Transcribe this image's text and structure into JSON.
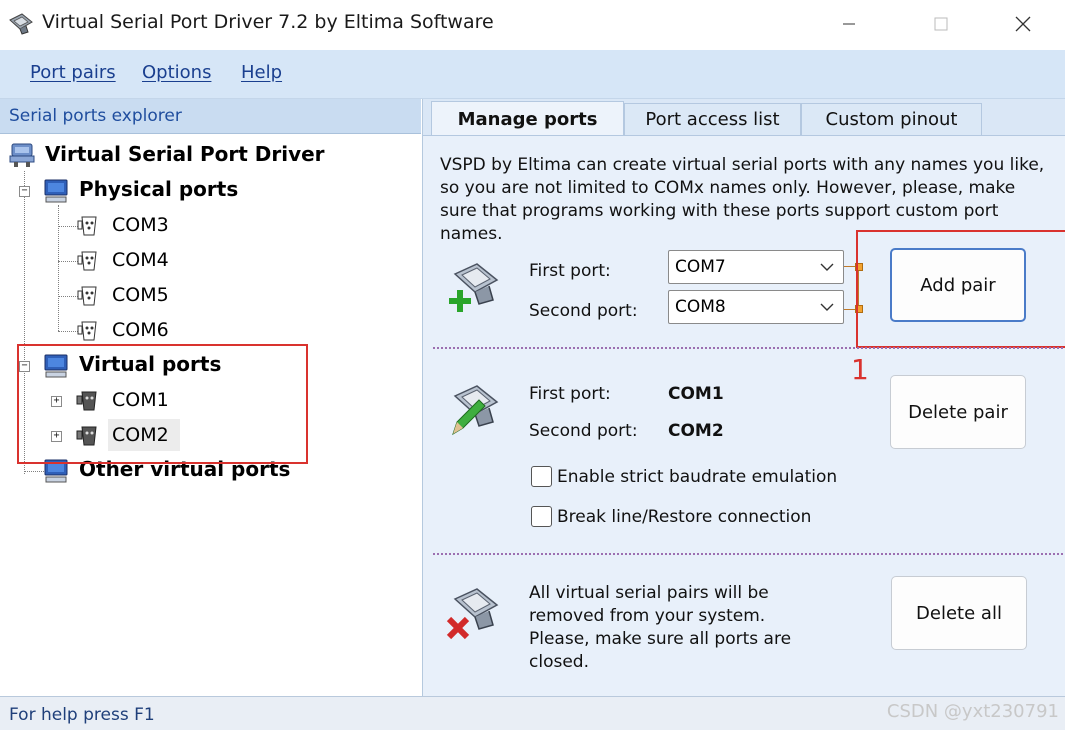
{
  "window": {
    "title": "Virtual Serial Port Driver 7.2 by Eltima Software"
  },
  "menu": [
    "Port pairs",
    "Options",
    "Help"
  ],
  "explorer": {
    "header": "Serial ports explorer",
    "root": "Virtual Serial Port Driver",
    "physical": {
      "label": "Physical ports",
      "ports": [
        "COM3",
        "COM4",
        "COM5",
        "COM6"
      ]
    },
    "virtual": {
      "label": "Virtual ports",
      "ports": [
        "COM1",
        "COM2"
      ],
      "selected": "COM2"
    },
    "other": {
      "label": "Other virtual ports"
    }
  },
  "tabs": [
    "Manage ports",
    "Port access list",
    "Custom pinout"
  ],
  "active_tab": "Manage ports",
  "manage": {
    "description": "VSPD by Eltima can create virtual serial ports with any names you like, so you are not limited to COMx names only. However, please, make sure that programs working with these ports support custom port names.",
    "add": {
      "first_label": "First port:",
      "first_value": "COM7",
      "second_label": "Second port:",
      "second_value": "COM8",
      "button": "Add pair"
    },
    "delete": {
      "first_label": "First port:",
      "first_value": "COM1",
      "second_label": "Second port:",
      "second_value": "COM2",
      "button": "Delete pair",
      "strict_baudrate": "Enable strict baudrate emulation",
      "break_line": "Break line/Restore connection"
    },
    "delete_all": {
      "text": "All virtual serial pairs will be removed from your system. Please, make sure all ports are closed.",
      "button": "Delete all"
    }
  },
  "annotation": {
    "number": "1"
  },
  "status": {
    "text": "For help press F1",
    "watermark": "CSDN @yxt230791"
  },
  "colors": {
    "menubar": "#d6e6f7",
    "panel": "#e8f0fa",
    "annotation_red": "#d9322e",
    "link_blue": "#1a3f8f"
  }
}
